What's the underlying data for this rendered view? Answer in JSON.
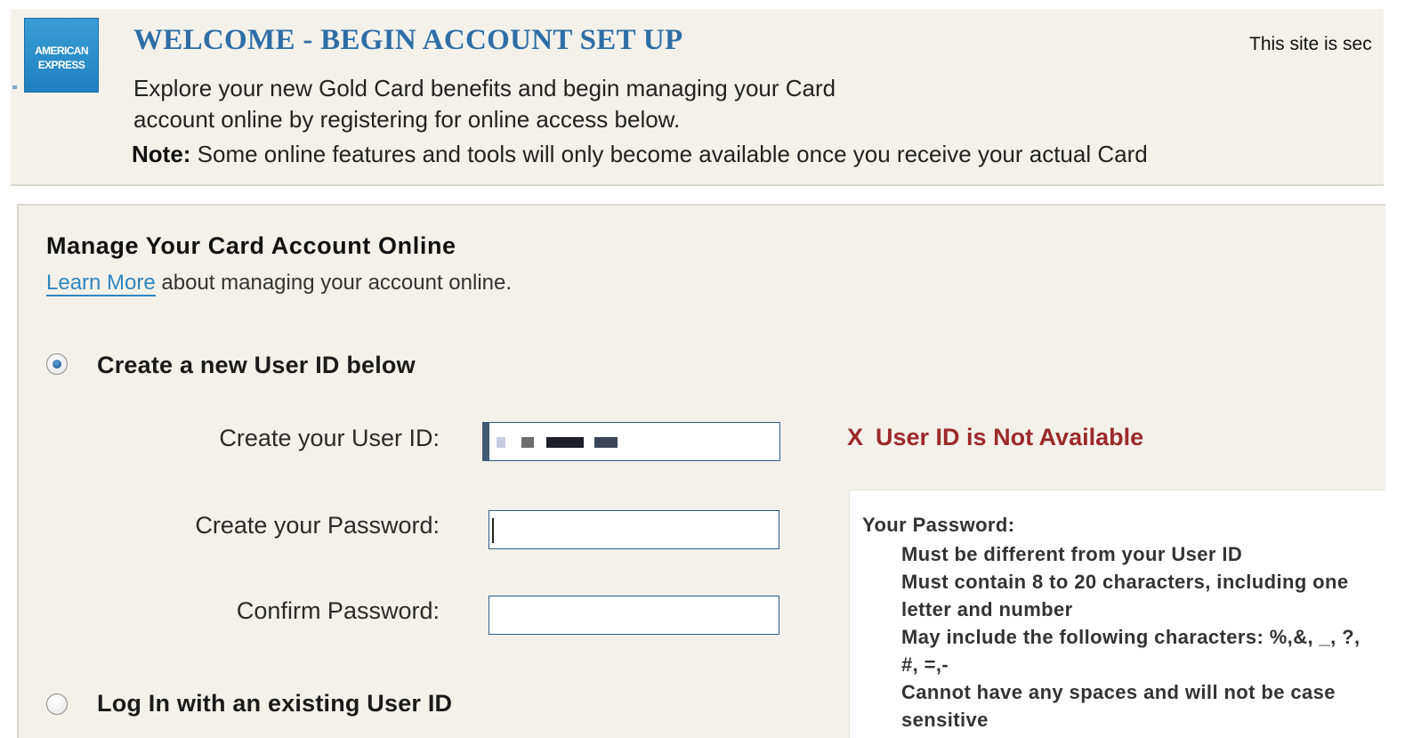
{
  "brand": {
    "logo_line1": "AMERICAN",
    "logo_line2": "EXPRESS",
    "logo_icon": "amex-logo"
  },
  "header": {
    "title": "WELCOME - BEGIN ACCOUNT SET UP",
    "secure_text": "This site is sec",
    "intro": "Explore your new Gold Card benefits and begin managing your Card account online by registering for online access below.",
    "note_label": "Note:",
    "note_text": " Some online features and tools will only become available once you receive your actual Card"
  },
  "panel": {
    "title": "Manage Your Card Account Online",
    "learn_more": "Learn More",
    "learn_more_suffix": " about managing your account online."
  },
  "options": {
    "create_label": "Create a new User ID below",
    "login_label": "Log In with an existing User ID",
    "selected": "create"
  },
  "form": {
    "user_id_label": "Create your User ID:",
    "user_id_value": "(pixelated)",
    "password_label": "Create your Password:",
    "password_value": "",
    "confirm_label": "Confirm Password:",
    "confirm_value": ""
  },
  "validation": {
    "icon": "X",
    "message": "User ID is Not Available",
    "color": "#9b2a2a"
  },
  "password_rules": {
    "title": "Your Password:",
    "items": [
      "Must be different from your User ID",
      "Must contain 8 to 20 characters, including one letter and number",
      "May include the following characters: %,&, _, ?, #, =,-",
      "Cannot have any spaces and will not be case sensitive"
    ]
  },
  "colors": {
    "title_blue": "#2e6ea6",
    "link_blue": "#2f86c2",
    "panel_bg": "#f4f1ea"
  }
}
